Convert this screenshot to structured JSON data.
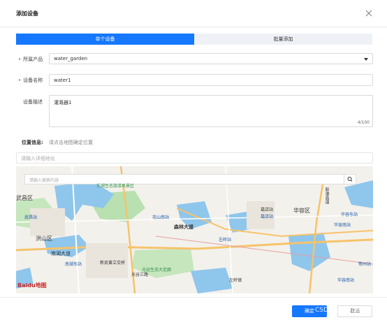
{
  "dialog": {
    "title": "添加设备",
    "close_icon": "close-icon"
  },
  "tabs": [
    {
      "label": "单个设备",
      "active": true
    },
    {
      "label": "批量添加",
      "active": false
    }
  ],
  "form": {
    "product": {
      "label": "所属产品",
      "value": "water_garden"
    },
    "name": {
      "label": "设备名称",
      "value": "water1"
    },
    "description": {
      "label": "设备描述",
      "value": "灌溉器1",
      "counter": "4/100"
    },
    "location": {
      "label": "位置信息:",
      "hint": "请点击地图确定位置"
    },
    "address": {
      "placeholder": "请输入详细地址"
    }
  },
  "map": {
    "search_placeholder": "请输入搜索内容",
    "labels": {
      "wuchang": "武昌区",
      "hongshan": "洪山区",
      "nanhu": "南湖大道",
      "senlin": "森林大道",
      "huarong": "华容区",
      "xinwu": "新武黄立交桥",
      "guanggu": "光谷三路",
      "gedian": "葛店站",
      "gedian2": "葛店南站",
      "xinggang": "新港高速",
      "wuhu": "武湖站"
    },
    "stations": [
      "武昌站",
      "花山南站",
      "左岭站",
      "葛店站",
      "南湖东站",
      "华容南站",
      "华容东站",
      "鄂州站",
      "华容南站",
      "左岭镇"
    ],
    "parks": [
      "东湖生态旅游风景区",
      "光谷生态大走廊"
    ],
    "logo": "Baidu地图"
  },
  "footer": {
    "ok_label": "确定",
    "cancel_label": "取消",
    "watermark": "CSDN @AI-Cement"
  },
  "colors": {
    "primary": "#1677ff",
    "map_bg": "#f3f1ec",
    "water": "#8fc6ec",
    "park": "#b8e0b0",
    "road": "#f6c36a"
  }
}
